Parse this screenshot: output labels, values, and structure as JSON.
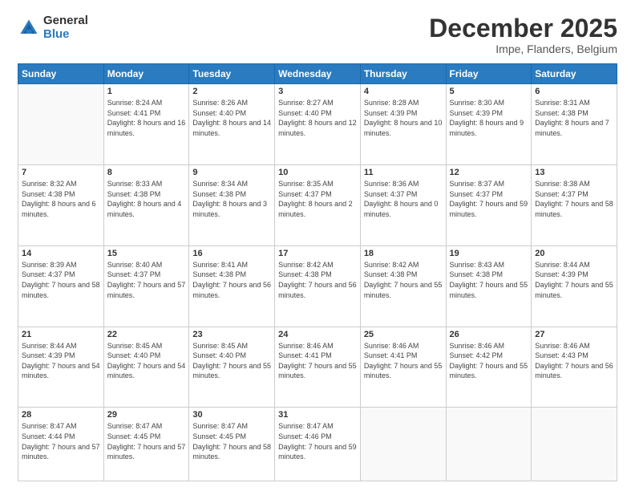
{
  "logo": {
    "general": "General",
    "blue": "Blue"
  },
  "header": {
    "title": "December 2025",
    "subtitle": "Impe, Flanders, Belgium"
  },
  "weekdays": [
    "Sunday",
    "Monday",
    "Tuesday",
    "Wednesday",
    "Thursday",
    "Friday",
    "Saturday"
  ],
  "weeks": [
    [
      {
        "day": "",
        "sunrise": "",
        "sunset": "",
        "daylight": ""
      },
      {
        "day": "1",
        "sunrise": "Sunrise: 8:24 AM",
        "sunset": "Sunset: 4:41 PM",
        "daylight": "Daylight: 8 hours and 16 minutes."
      },
      {
        "day": "2",
        "sunrise": "Sunrise: 8:26 AM",
        "sunset": "Sunset: 4:40 PM",
        "daylight": "Daylight: 8 hours and 14 minutes."
      },
      {
        "day": "3",
        "sunrise": "Sunrise: 8:27 AM",
        "sunset": "Sunset: 4:40 PM",
        "daylight": "Daylight: 8 hours and 12 minutes."
      },
      {
        "day": "4",
        "sunrise": "Sunrise: 8:28 AM",
        "sunset": "Sunset: 4:39 PM",
        "daylight": "Daylight: 8 hours and 10 minutes."
      },
      {
        "day": "5",
        "sunrise": "Sunrise: 8:30 AM",
        "sunset": "Sunset: 4:39 PM",
        "daylight": "Daylight: 8 hours and 9 minutes."
      },
      {
        "day": "6",
        "sunrise": "Sunrise: 8:31 AM",
        "sunset": "Sunset: 4:38 PM",
        "daylight": "Daylight: 8 hours and 7 minutes."
      }
    ],
    [
      {
        "day": "7",
        "sunrise": "Sunrise: 8:32 AM",
        "sunset": "Sunset: 4:38 PM",
        "daylight": "Daylight: 8 hours and 6 minutes."
      },
      {
        "day": "8",
        "sunrise": "Sunrise: 8:33 AM",
        "sunset": "Sunset: 4:38 PM",
        "daylight": "Daylight: 8 hours and 4 minutes."
      },
      {
        "day": "9",
        "sunrise": "Sunrise: 8:34 AM",
        "sunset": "Sunset: 4:38 PM",
        "daylight": "Daylight: 8 hours and 3 minutes."
      },
      {
        "day": "10",
        "sunrise": "Sunrise: 8:35 AM",
        "sunset": "Sunset: 4:37 PM",
        "daylight": "Daylight: 8 hours and 2 minutes."
      },
      {
        "day": "11",
        "sunrise": "Sunrise: 8:36 AM",
        "sunset": "Sunset: 4:37 PM",
        "daylight": "Daylight: 8 hours and 0 minutes."
      },
      {
        "day": "12",
        "sunrise": "Sunrise: 8:37 AM",
        "sunset": "Sunset: 4:37 PM",
        "daylight": "Daylight: 7 hours and 59 minutes."
      },
      {
        "day": "13",
        "sunrise": "Sunrise: 8:38 AM",
        "sunset": "Sunset: 4:37 PM",
        "daylight": "Daylight: 7 hours and 58 minutes."
      }
    ],
    [
      {
        "day": "14",
        "sunrise": "Sunrise: 8:39 AM",
        "sunset": "Sunset: 4:37 PM",
        "daylight": "Daylight: 7 hours and 58 minutes."
      },
      {
        "day": "15",
        "sunrise": "Sunrise: 8:40 AM",
        "sunset": "Sunset: 4:37 PM",
        "daylight": "Daylight: 7 hours and 57 minutes."
      },
      {
        "day": "16",
        "sunrise": "Sunrise: 8:41 AM",
        "sunset": "Sunset: 4:38 PM",
        "daylight": "Daylight: 7 hours and 56 minutes."
      },
      {
        "day": "17",
        "sunrise": "Sunrise: 8:42 AM",
        "sunset": "Sunset: 4:38 PM",
        "daylight": "Daylight: 7 hours and 56 minutes."
      },
      {
        "day": "18",
        "sunrise": "Sunrise: 8:42 AM",
        "sunset": "Sunset: 4:38 PM",
        "daylight": "Daylight: 7 hours and 55 minutes."
      },
      {
        "day": "19",
        "sunrise": "Sunrise: 8:43 AM",
        "sunset": "Sunset: 4:38 PM",
        "daylight": "Daylight: 7 hours and 55 minutes."
      },
      {
        "day": "20",
        "sunrise": "Sunrise: 8:44 AM",
        "sunset": "Sunset: 4:39 PM",
        "daylight": "Daylight: 7 hours and 55 minutes."
      }
    ],
    [
      {
        "day": "21",
        "sunrise": "Sunrise: 8:44 AM",
        "sunset": "Sunset: 4:39 PM",
        "daylight": "Daylight: 7 hours and 54 minutes."
      },
      {
        "day": "22",
        "sunrise": "Sunrise: 8:45 AM",
        "sunset": "Sunset: 4:40 PM",
        "daylight": "Daylight: 7 hours and 54 minutes."
      },
      {
        "day": "23",
        "sunrise": "Sunrise: 8:45 AM",
        "sunset": "Sunset: 4:40 PM",
        "daylight": "Daylight: 7 hours and 55 minutes."
      },
      {
        "day": "24",
        "sunrise": "Sunrise: 8:46 AM",
        "sunset": "Sunset: 4:41 PM",
        "daylight": "Daylight: 7 hours and 55 minutes."
      },
      {
        "day": "25",
        "sunrise": "Sunrise: 8:46 AM",
        "sunset": "Sunset: 4:41 PM",
        "daylight": "Daylight: 7 hours and 55 minutes."
      },
      {
        "day": "26",
        "sunrise": "Sunrise: 8:46 AM",
        "sunset": "Sunset: 4:42 PM",
        "daylight": "Daylight: 7 hours and 55 minutes."
      },
      {
        "day": "27",
        "sunrise": "Sunrise: 8:46 AM",
        "sunset": "Sunset: 4:43 PM",
        "daylight": "Daylight: 7 hours and 56 minutes."
      }
    ],
    [
      {
        "day": "28",
        "sunrise": "Sunrise: 8:47 AM",
        "sunset": "Sunset: 4:44 PM",
        "daylight": "Daylight: 7 hours and 57 minutes."
      },
      {
        "day": "29",
        "sunrise": "Sunrise: 8:47 AM",
        "sunset": "Sunset: 4:45 PM",
        "daylight": "Daylight: 7 hours and 57 minutes."
      },
      {
        "day": "30",
        "sunrise": "Sunrise: 8:47 AM",
        "sunset": "Sunset: 4:45 PM",
        "daylight": "Daylight: 7 hours and 58 minutes."
      },
      {
        "day": "31",
        "sunrise": "Sunrise: 8:47 AM",
        "sunset": "Sunset: 4:46 PM",
        "daylight": "Daylight: 7 hours and 59 minutes."
      },
      {
        "day": "",
        "sunrise": "",
        "sunset": "",
        "daylight": ""
      },
      {
        "day": "",
        "sunrise": "",
        "sunset": "",
        "daylight": ""
      },
      {
        "day": "",
        "sunrise": "",
        "sunset": "",
        "daylight": ""
      }
    ]
  ]
}
